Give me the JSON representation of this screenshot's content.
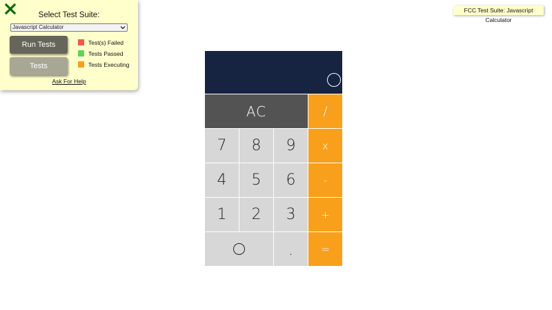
{
  "test_panel": {
    "title": "Select Test Suite:",
    "selected_suite": "Javascript Calculator",
    "run_button_label": "Run Tests",
    "tests_button_label": "Tests",
    "legend": [
      {
        "label": "Test(s) Failed",
        "color": "#f25a4a"
      },
      {
        "label": "Tests Passed",
        "color": "#5fd35f"
      },
      {
        "label": "Tests Executing",
        "color": "#f8a01c"
      }
    ],
    "help_link": "Ask For Help",
    "close_icon_color": "#0b6b0b"
  },
  "badge": {
    "text": "FCC Test Suite: Javascript Calculator"
  },
  "calculator": {
    "display_value": "0",
    "colors": {
      "display_bg": "#162341",
      "number_key": "#d7d7d7",
      "operator_key": "#f8a01c",
      "clear_key": "#535353"
    },
    "keys": {
      "clear": "AC",
      "divide": "/",
      "multiply": "x",
      "subtract": "-",
      "add": "+",
      "equals": "=",
      "decimal": ".",
      "seven": "7",
      "eight": "8",
      "nine": "9",
      "four": "4",
      "five": "5",
      "six": "6",
      "one": "1",
      "two": "2",
      "three": "3",
      "zero": "0"
    }
  }
}
